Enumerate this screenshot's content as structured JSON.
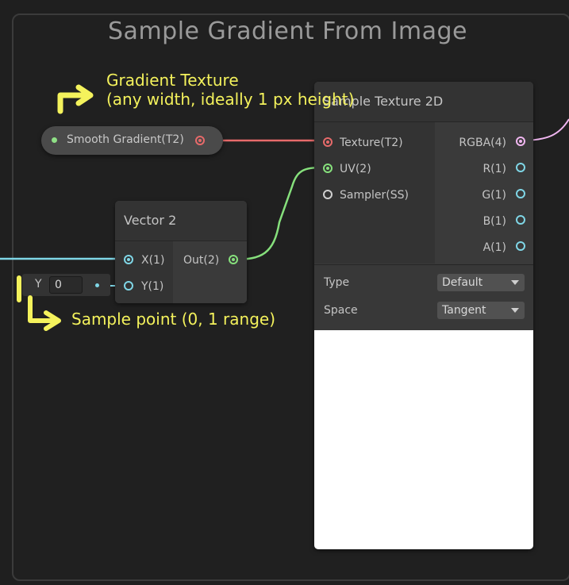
{
  "group": {
    "title": "Sample Gradient From Image"
  },
  "property_node": {
    "label": "Smooth Gradient(T2)"
  },
  "vector2_node": {
    "title": "Vector 2",
    "inputs": [
      "X(1)",
      "Y(1)"
    ],
    "output": "Out(2)",
    "y_field": {
      "label": "Y",
      "value": "0"
    }
  },
  "sample_texture_node": {
    "title": "Sample Texture 2D",
    "inputs": [
      "Texture(T2)",
      "UV(2)",
      "Sampler(SS)"
    ],
    "outputs": [
      "RGBA(4)",
      "R(1)",
      "G(1)",
      "B(1)",
      "A(1)"
    ],
    "settings": [
      {
        "label": "Type",
        "value": "Default"
      },
      {
        "label": "Space",
        "value": "Tangent"
      }
    ]
  },
  "annotations": {
    "gradient_line1": "Gradient Texture",
    "gradient_line2": "(any width, ideally 1 px height)",
    "sample_point": "Sample point (0, 1 range)"
  },
  "colors": {
    "texture_port": "#e66a6a",
    "vector_port": "#86e07c",
    "float_port": "#7fd6e6",
    "rgba_port": "#f0b6f0",
    "annotation": "#f4f25c"
  }
}
